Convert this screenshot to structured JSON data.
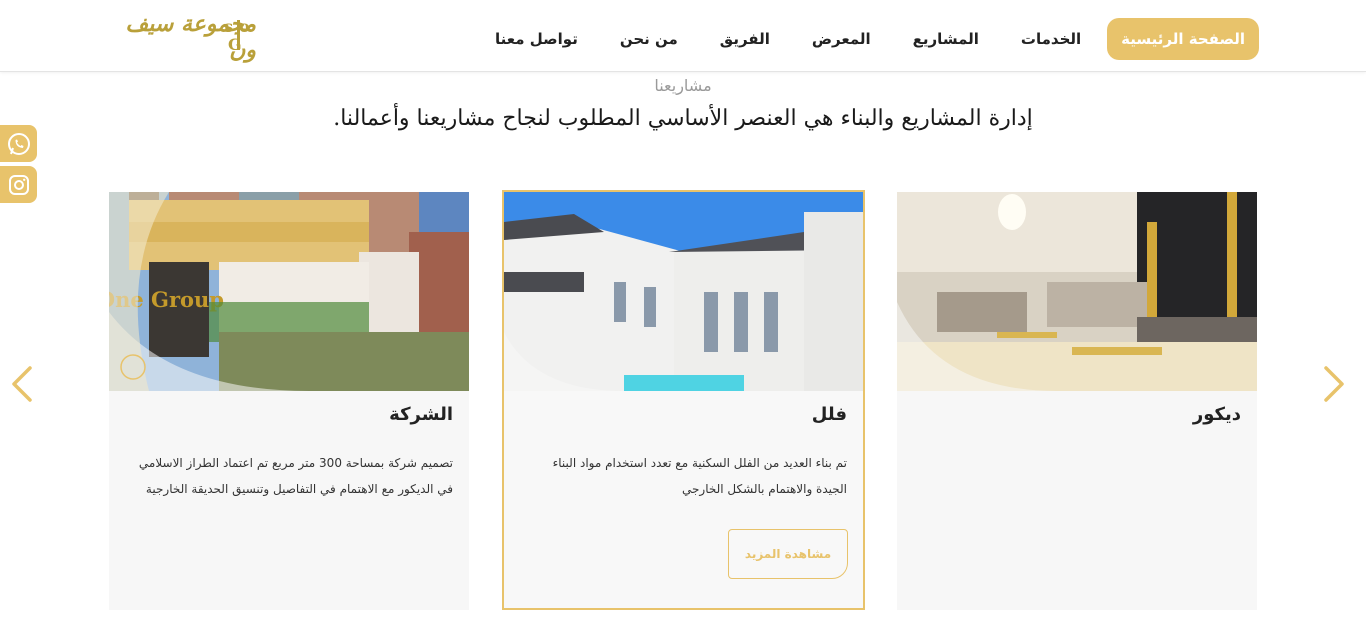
{
  "brand": {
    "logo_text": "مجموعة سيف ون"
  },
  "nav": {
    "items": [
      {
        "label": "الصفحة الرئيسية",
        "active": true
      },
      {
        "label": "الخدمات",
        "active": false
      },
      {
        "label": "المشاريع",
        "active": false
      },
      {
        "label": "المعرض",
        "active": false
      },
      {
        "label": "الفريق",
        "active": false
      },
      {
        "label": "من نحن",
        "active": false
      },
      {
        "label": "تواصل معنا",
        "active": false
      }
    ]
  },
  "section": {
    "kicker": "مشاريعنا",
    "headline": "إدارة المشاريع والبناء هي العنصر الأساسي المطلوب لنجاح مشاريعنا وأعمالنا."
  },
  "cards": [
    {
      "title": "الشركة",
      "description": "تصميم شركة بمساحة 300 متر مربع تم اعتماد الطراز الاسلامي في الديكور مع الاهتمام في التفاصيل وتنسيق الحديقة الخارجية",
      "image_sign": "Safe One Group"
    },
    {
      "title": "فلل",
      "description": "تم بناء العديد من الفلل السكنية مع تعدد استخدام مواد البناء الجيدة والاهتمام بالشكل الخارجي",
      "button_label": "مشاهدة المزيد"
    },
    {
      "title": "ديكور",
      "description": ""
    }
  ],
  "colors": {
    "accent": "#e8c36b",
    "logo_gold": "#b9a03a",
    "card_bg": "#f7f7f7"
  },
  "icons": {
    "social": [
      "whatsapp-icon",
      "instagram-icon"
    ],
    "arrows": [
      "chevron-left-icon",
      "chevron-right-icon"
    ]
  }
}
